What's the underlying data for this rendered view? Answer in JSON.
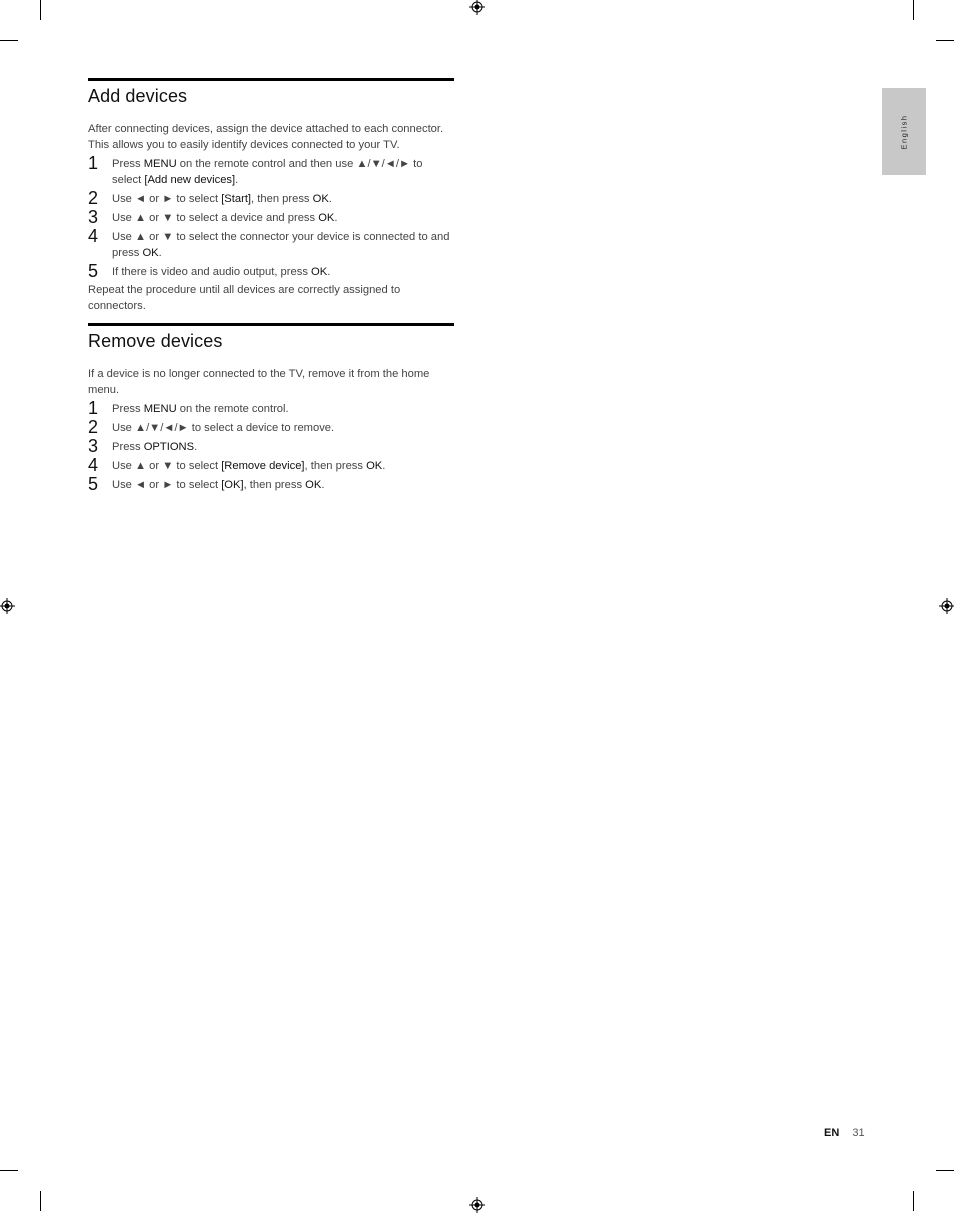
{
  "language_tab": "English",
  "sections": [
    {
      "title": "Add devices",
      "intro": "After connecting devices, assign the device attached to each connector. This allows you to easily identify devices connected to your TV.",
      "steps": [
        {
          "num": "1",
          "parts": [
            "Press ",
            "MENU",
            " on the remote control and then use ▲/▼/◄/► to select ",
            "[Add new devices]",
            "."
          ]
        },
        {
          "num": "2",
          "parts": [
            "Use ◄ or ► to select ",
            "[Start]",
            ", then press ",
            "OK",
            "."
          ]
        },
        {
          "num": "3",
          "parts": [
            "Use ▲ or ▼ to select a device and press ",
            "OK",
            "."
          ]
        },
        {
          "num": "4",
          "parts": [
            "Use ▲ or ▼ to select the connector your device is connected to and press ",
            "OK",
            "."
          ]
        },
        {
          "num": "5",
          "parts": [
            "If there is video and audio output, press ",
            "OK",
            "."
          ]
        }
      ],
      "outro": "Repeat the procedure until all devices are correctly assigned to connectors."
    },
    {
      "title": "Remove devices",
      "intro": "If a device is no longer connected to the TV, remove it from the home menu.",
      "steps": [
        {
          "num": "1",
          "parts": [
            "Press ",
            "MENU",
            " on the remote control."
          ]
        },
        {
          "num": "2",
          "parts": [
            "Use ▲/▼/◄/► to select a device to remove."
          ]
        },
        {
          "num": "3",
          "parts": [
            "Press ",
            "OPTIONS",
            "."
          ]
        },
        {
          "num": "4",
          "parts": [
            "Use ▲ or ▼ to select ",
            "[Remove device]",
            ", then press ",
            "OK",
            "."
          ]
        },
        {
          "num": "5",
          "parts": [
            "Use ◄ or ► to select ",
            "[OK]",
            ", then press ",
            "OK",
            "."
          ]
        }
      ],
      "outro": ""
    }
  ],
  "footer": {
    "lang_code": "EN",
    "page_number": "31"
  }
}
